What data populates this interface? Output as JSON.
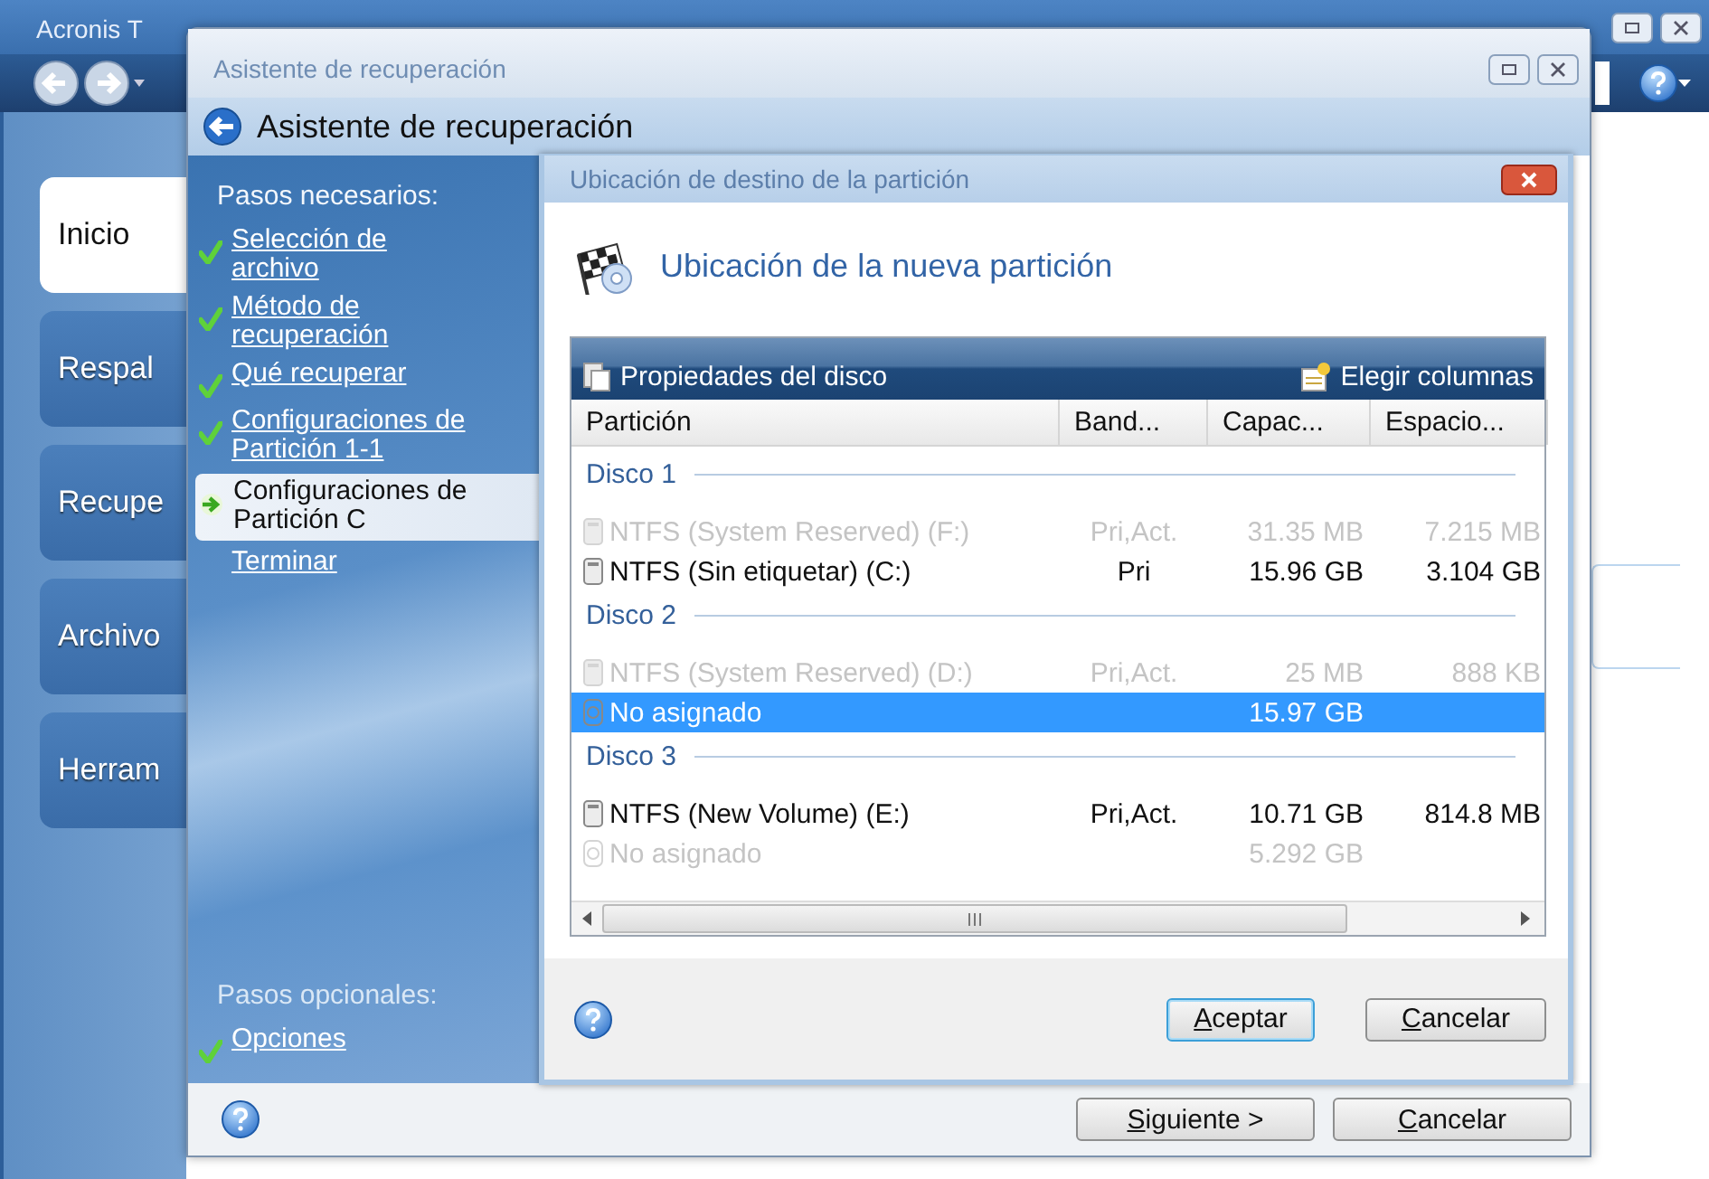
{
  "app": {
    "title": "Acronis T",
    "nav": [
      {
        "label": "Inicio",
        "selected": true
      },
      {
        "label": "Respal",
        "selected": false
      },
      {
        "label": "Recupe",
        "selected": false
      },
      {
        "label": "Archivo",
        "selected": false
      },
      {
        "label": "Herram",
        "selected": false
      }
    ]
  },
  "wizard": {
    "title": "Asistente de recuperación",
    "header": "Asistente de recuperación",
    "required_label": "Pasos necesarios:",
    "steps": [
      {
        "label": "Selección de archivo",
        "checked": true,
        "selected": false
      },
      {
        "label": "Método de recuperación",
        "checked": true,
        "selected": false
      },
      {
        "label": "Qué recuperar",
        "checked": true,
        "selected": false
      },
      {
        "label": "Configuraciones de Partición 1-1",
        "checked": true,
        "selected": false
      },
      {
        "label": "Configuraciones de Partición C",
        "checked": false,
        "selected": true
      },
      {
        "label": "Terminar",
        "checked": false,
        "selected": false
      }
    ],
    "optional_label": "Pasos opcionales:",
    "optional_steps": [
      {
        "label": "Opciones",
        "checked": true,
        "selected": false
      }
    ],
    "buttons": [
      "Siguiente >",
      "Cancelar"
    ]
  },
  "dialog": {
    "title": "Ubicación de destino de la partición",
    "heading": "Ubicación de la nueva partición",
    "toolbar": {
      "left": "Propiedades del disco",
      "right": "Elegir columnas"
    },
    "columns": [
      "Partición",
      "Band...",
      "Capac...",
      "Espacio..."
    ],
    "groups": [
      {
        "name": "Disco 1",
        "rows": [
          {
            "kind": "ntfs",
            "partition": "NTFS (System Reserved) (F:)",
            "flags": "Pri,Act.",
            "capacity": "31.35 MB",
            "free": "7.215 MB",
            "disabled": true,
            "selected": false
          },
          {
            "kind": "ntfs",
            "partition": "NTFS (Sin etiquetar) (C:)",
            "flags": "Pri",
            "capacity": "15.96 GB",
            "free": "3.104 GB",
            "disabled": false,
            "selected": false
          }
        ]
      },
      {
        "name": "Disco 2",
        "rows": [
          {
            "kind": "ntfs",
            "partition": "NTFS (System Reserved) (D:)",
            "flags": "Pri,Act.",
            "capacity": "25 MB",
            "free": "888 KB",
            "disabled": true,
            "selected": false
          },
          {
            "kind": "unallocated",
            "partition": "No asignado",
            "capacity": "15.97 GB",
            "disabled": false,
            "selected": true
          }
        ]
      },
      {
        "name": "Disco 3",
        "rows": [
          {
            "kind": "ntfs",
            "partition": "NTFS (New Volume) (E:)",
            "flags": "Pri,Act.",
            "capacity": "10.71 GB",
            "free": "814.8 MB",
            "disabled": false,
            "selected": false
          },
          {
            "kind": "unallocated",
            "partition": "No asignado",
            "capacity": "5.292 GB",
            "disabled": true,
            "selected": false
          }
        ]
      }
    ],
    "buttons": [
      {
        "label": "Aceptar",
        "default": true
      },
      {
        "label": "Cancelar",
        "default": false
      }
    ]
  }
}
